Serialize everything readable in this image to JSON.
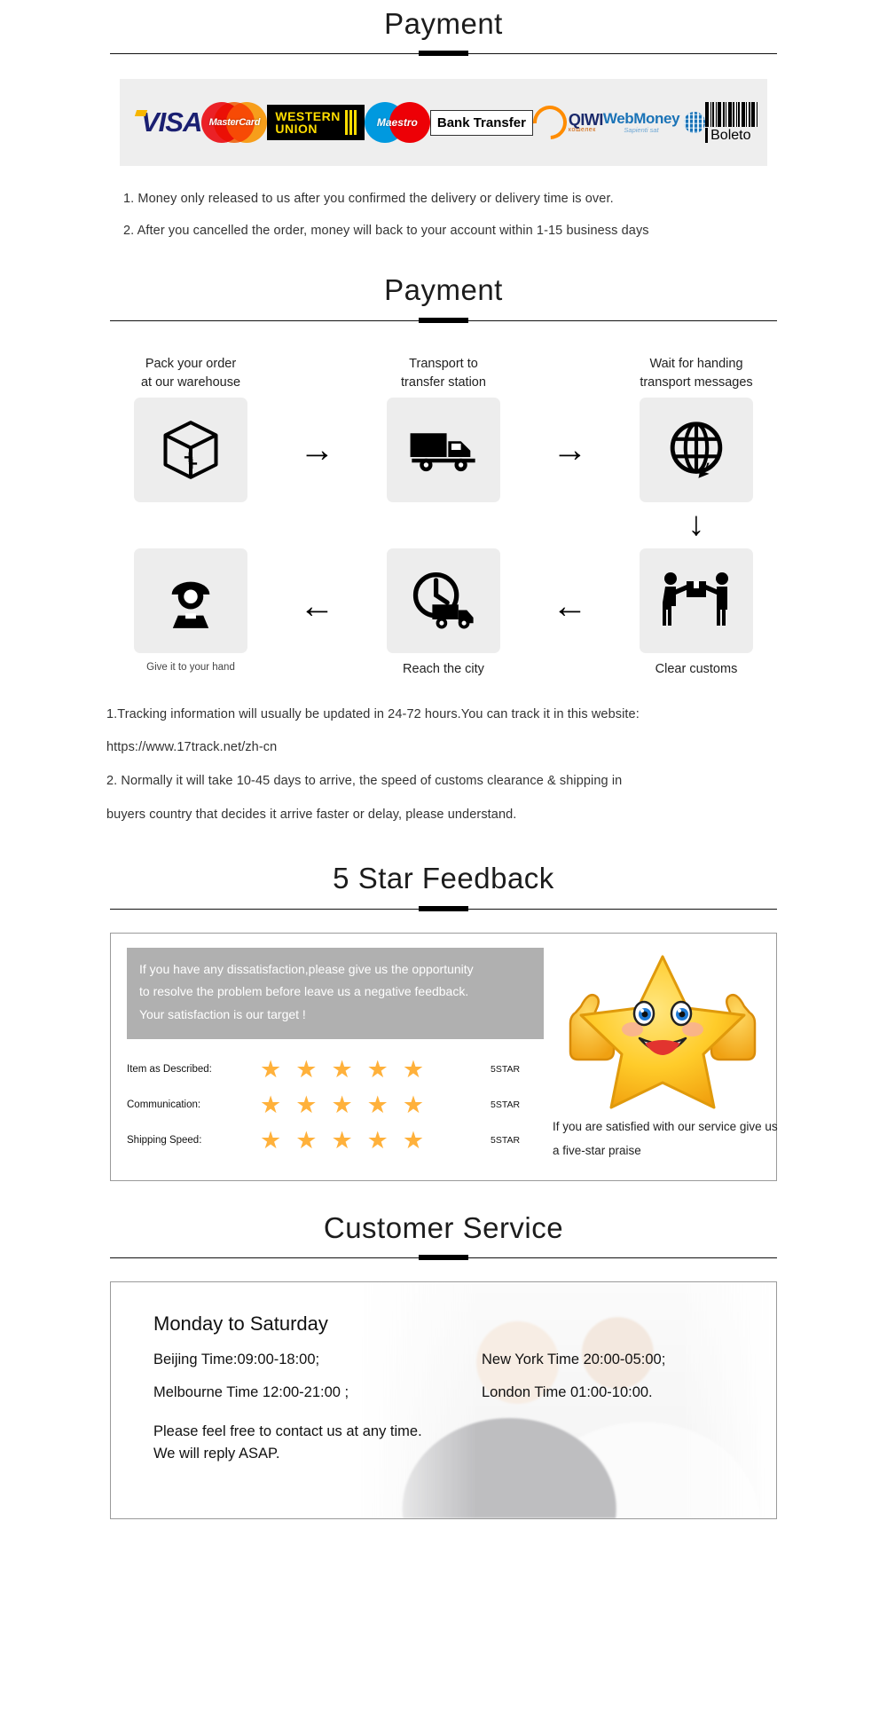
{
  "payment_section": {
    "heading": "Payment",
    "logos": [
      {
        "name": "visa-logo",
        "label": "VISA"
      },
      {
        "name": "mastercard-logo",
        "label": "MasterCard"
      },
      {
        "name": "western-union-logo",
        "label_top": "WESTERN",
        "label_bottom": "UNION"
      },
      {
        "name": "maestro-logo",
        "label": "Maestro"
      },
      {
        "name": "bank-transfer-logo",
        "label": "Bank Transfer"
      },
      {
        "name": "qiwi-logo",
        "label": "QIWI",
        "sublabel": "кошелек"
      },
      {
        "name": "webmoney-logo",
        "label": "WebMoney",
        "sublabel": "Sapienti sat"
      },
      {
        "name": "boleto-logo",
        "label": "Boleto"
      }
    ],
    "notes": [
      "1. Money only released to us after you confirmed the delivery or delivery time is over.",
      "2. After you cancelled the order, money will back to your account within 1-15  business days"
    ]
  },
  "shipping_section": {
    "heading": "Payment",
    "steps_row1": [
      {
        "icon": "package-box-icon",
        "label_line1": "Pack your order",
        "label_line2": "at our warehouse"
      },
      {
        "icon": "delivery-truck-icon",
        "label_line1": "Transport to",
        "label_line2": "transfer station"
      },
      {
        "icon": "globe-recycle-icon",
        "label_line1": "Wait for handing",
        "label_line2": "transport messages"
      }
    ],
    "steps_row2": [
      {
        "icon": "customer-person-icon",
        "label": "Give it to your hand"
      },
      {
        "icon": "clock-truck-icon",
        "label": "Reach the city"
      },
      {
        "icon": "handover-workers-icon",
        "label": "Clear customs"
      }
    ],
    "arrow_right": "→",
    "arrow_left": "←",
    "arrow_down": "↓",
    "tracking_notes": [
      "1.Tracking information will usually be updated in 24-72 hours.You can track it in this website:",
      "https://www.17track.net/zh-cn",
      "2. Normally it will take 10-45 days to arrive, the speed of customs clearance & shipping in",
      "buyers country that decides it arrive faster or delay, please understand."
    ]
  },
  "feedback_section": {
    "heading": "5 Star Feedback",
    "banner_lines": [
      "If you have any dissatisfaction,please give us the opportunity",
      "to resolve the problem before leave us a negative feedback.",
      "Your satisfaction is our target !"
    ],
    "ratings": [
      {
        "label": "Item as Described:",
        "stars": 5,
        "value": "5STAR"
      },
      {
        "label": "Communication:",
        "stars": 5,
        "value": "5STAR"
      },
      {
        "label": "Shipping Speed:",
        "stars": 5,
        "value": "5STAR"
      }
    ],
    "star_color": "#ffb13b",
    "caption_lines": [
      "If you are satisfied with our service give us",
      "a five-star praise"
    ]
  },
  "customer_service_section": {
    "heading": "Customer Service",
    "title": "Monday to Saturday",
    "hours": [
      {
        "left": "Beijing Time:09:00-18:00;",
        "right": "New York Time 20:00-05:00;"
      },
      {
        "left": "Melbourne Time 12:00-21:00 ;",
        "right": "London Time 01:00-10:00."
      }
    ],
    "footer_line1": "Please feel free to contact us at any time.",
    "footer_line2": "We will reply ASAP."
  }
}
